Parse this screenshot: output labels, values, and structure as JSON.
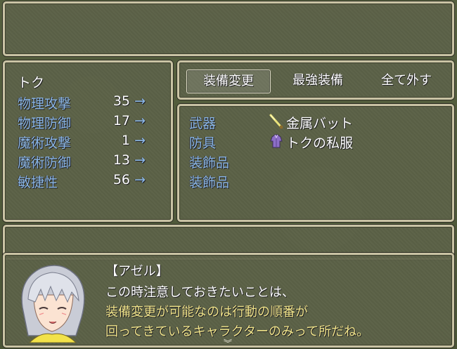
{
  "status": {
    "actor_name": "トク",
    "stats": [
      {
        "label": "物理攻撃",
        "value": "35",
        "arrow": "→"
      },
      {
        "label": "物理防御",
        "value": "17",
        "arrow": "→"
      },
      {
        "label": "魔術攻撃",
        "value": "1",
        "arrow": "→"
      },
      {
        "label": "魔術防御",
        "value": "13",
        "arrow": "→"
      },
      {
        "label": "敏捷性",
        "value": "56",
        "arrow": "→"
      }
    ]
  },
  "commands": [
    {
      "label": "装備変更",
      "selected": true
    },
    {
      "label": "最強装備",
      "selected": false
    },
    {
      "label": "全て外す",
      "selected": false
    }
  ],
  "slots": [
    {
      "slot": "武器",
      "item": "金属バット",
      "icon": "bat-icon"
    },
    {
      "slot": "防具",
      "item": "トクの私服",
      "icon": "clothes-icon"
    },
    {
      "slot": "装飾品",
      "item": "",
      "icon": ""
    },
    {
      "slot": "装飾品",
      "item": "",
      "icon": ""
    }
  ],
  "message": {
    "speaker": "【アゼル】",
    "line1": "この時注意しておきたいことは、",
    "line2": "装備変更が可能なのは行動の順番が",
    "line3": "回ってきているキャラクターのみって所だね。",
    "pause": "︾"
  },
  "colors": {
    "system_blue": "#8ab6e6",
    "highlight_yellow": "#f1e58a",
    "window_border": "#c9c3a4"
  }
}
